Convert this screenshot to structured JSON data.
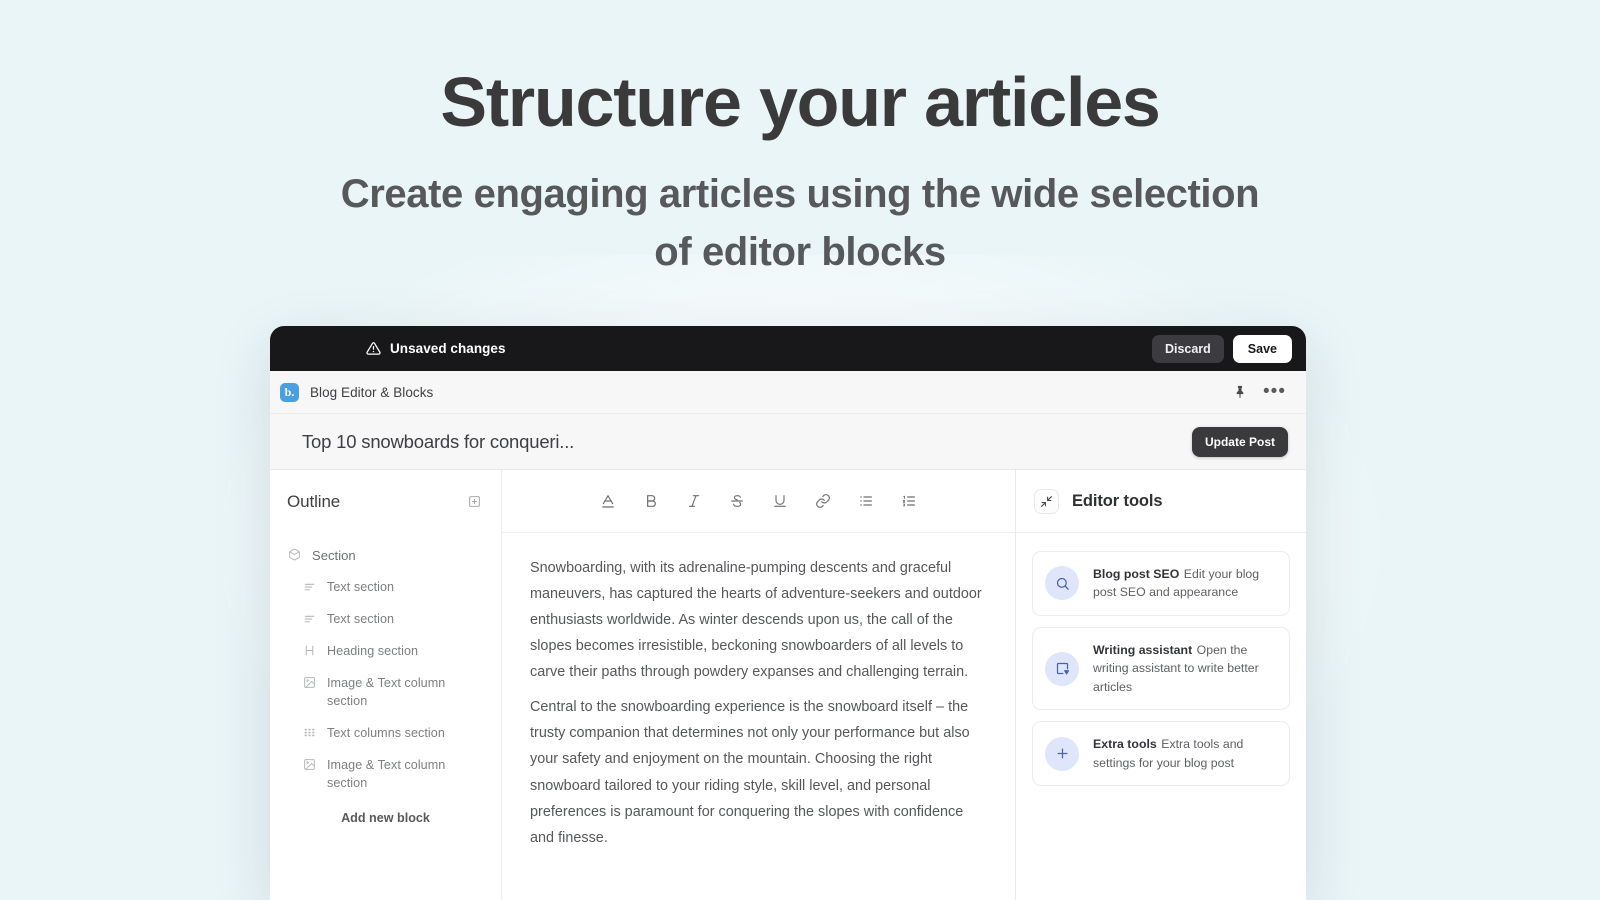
{
  "hero": {
    "title": "Structure your articles",
    "subtitle": "Create engaging articles using the wide selection of editor blocks"
  },
  "colors": {
    "page_background": "#e9f5f7",
    "topbar_background": "#18181b",
    "brand_blue": "#4a9fe0",
    "tool_icon_bg": "#dfe6fb",
    "tool_icon_fg": "#4a5fb5",
    "update_button_bg": "#3a3a3d"
  },
  "unsaved_bar": {
    "icon": "warning-triangle-icon",
    "label": "Unsaved changes",
    "discard_label": "Discard",
    "save_label": "Save"
  },
  "app_bar": {
    "logo_letter": "b.",
    "title": "Blog Editor & Blocks",
    "pin_icon": "pin-icon",
    "more_icon": "more-horizontal-icon",
    "more_glyph": "•••"
  },
  "post_bar": {
    "title": "Top 10 snowboards for conqueri...",
    "update_label": "Update Post"
  },
  "outline": {
    "title": "Outline",
    "add_icon": "plus-square-icon",
    "items": [
      {
        "label": "Section",
        "icon": "box-icon",
        "level": "root"
      },
      {
        "label": "Text section",
        "icon": "text-lines-icon",
        "level": "child"
      },
      {
        "label": "Text section",
        "icon": "text-lines-icon",
        "level": "child"
      },
      {
        "label": "Heading section",
        "icon": "heading-icon",
        "level": "child"
      },
      {
        "label": "Image & Text column section",
        "icon": "image-icon",
        "level": "child"
      },
      {
        "label": "Text columns section",
        "icon": "columns-icon",
        "level": "child"
      },
      {
        "label": "Image & Text column section",
        "icon": "image-icon",
        "level": "child"
      }
    ],
    "add_new_block_label": "Add new block"
  },
  "editor": {
    "toolbar": [
      {
        "name": "text-color-icon",
        "label": "A"
      },
      {
        "name": "bold-icon",
        "label": "B"
      },
      {
        "name": "italic-icon",
        "label": "I"
      },
      {
        "name": "strikethrough-icon",
        "label": "S"
      },
      {
        "name": "underline-icon",
        "label": "U"
      },
      {
        "name": "link-icon",
        "label": "link"
      },
      {
        "name": "bullet-list-icon",
        "label": "list"
      },
      {
        "name": "numbered-list-icon",
        "label": "ordered-list"
      }
    ],
    "paragraphs": [
      "Snowboarding, with its adrenaline-pumping descents and graceful maneuvers, has captured the hearts of adventure-seekers and outdoor enthusiasts worldwide. As winter descends upon us, the call of the slopes becomes irresistible, beckoning snowboarders of all levels to carve their paths through powdery expanses and challenging terrain.",
      "Central to the snowboarding experience is the snowboard itself – the trusty companion that determines not only your performance but also your safety and enjoyment on the mountain. Choosing the right snowboard tailored to your riding style, skill level, and personal preferences is paramount for conquering the slopes with confidence and finesse."
    ]
  },
  "tools": {
    "header_icon": "collapse-diagonal-icon",
    "title": "Editor tools",
    "cards": [
      {
        "icon": "search-icon",
        "name": "Blog post SEO",
        "description": "Edit your blog post SEO and appearance"
      },
      {
        "icon": "writing-assistant-icon",
        "name": "Writing assistant",
        "description": "Open the writing assistant to write better articles"
      },
      {
        "icon": "plus-icon",
        "name": "Extra tools",
        "description": "Extra tools and settings for your blog post"
      }
    ]
  }
}
